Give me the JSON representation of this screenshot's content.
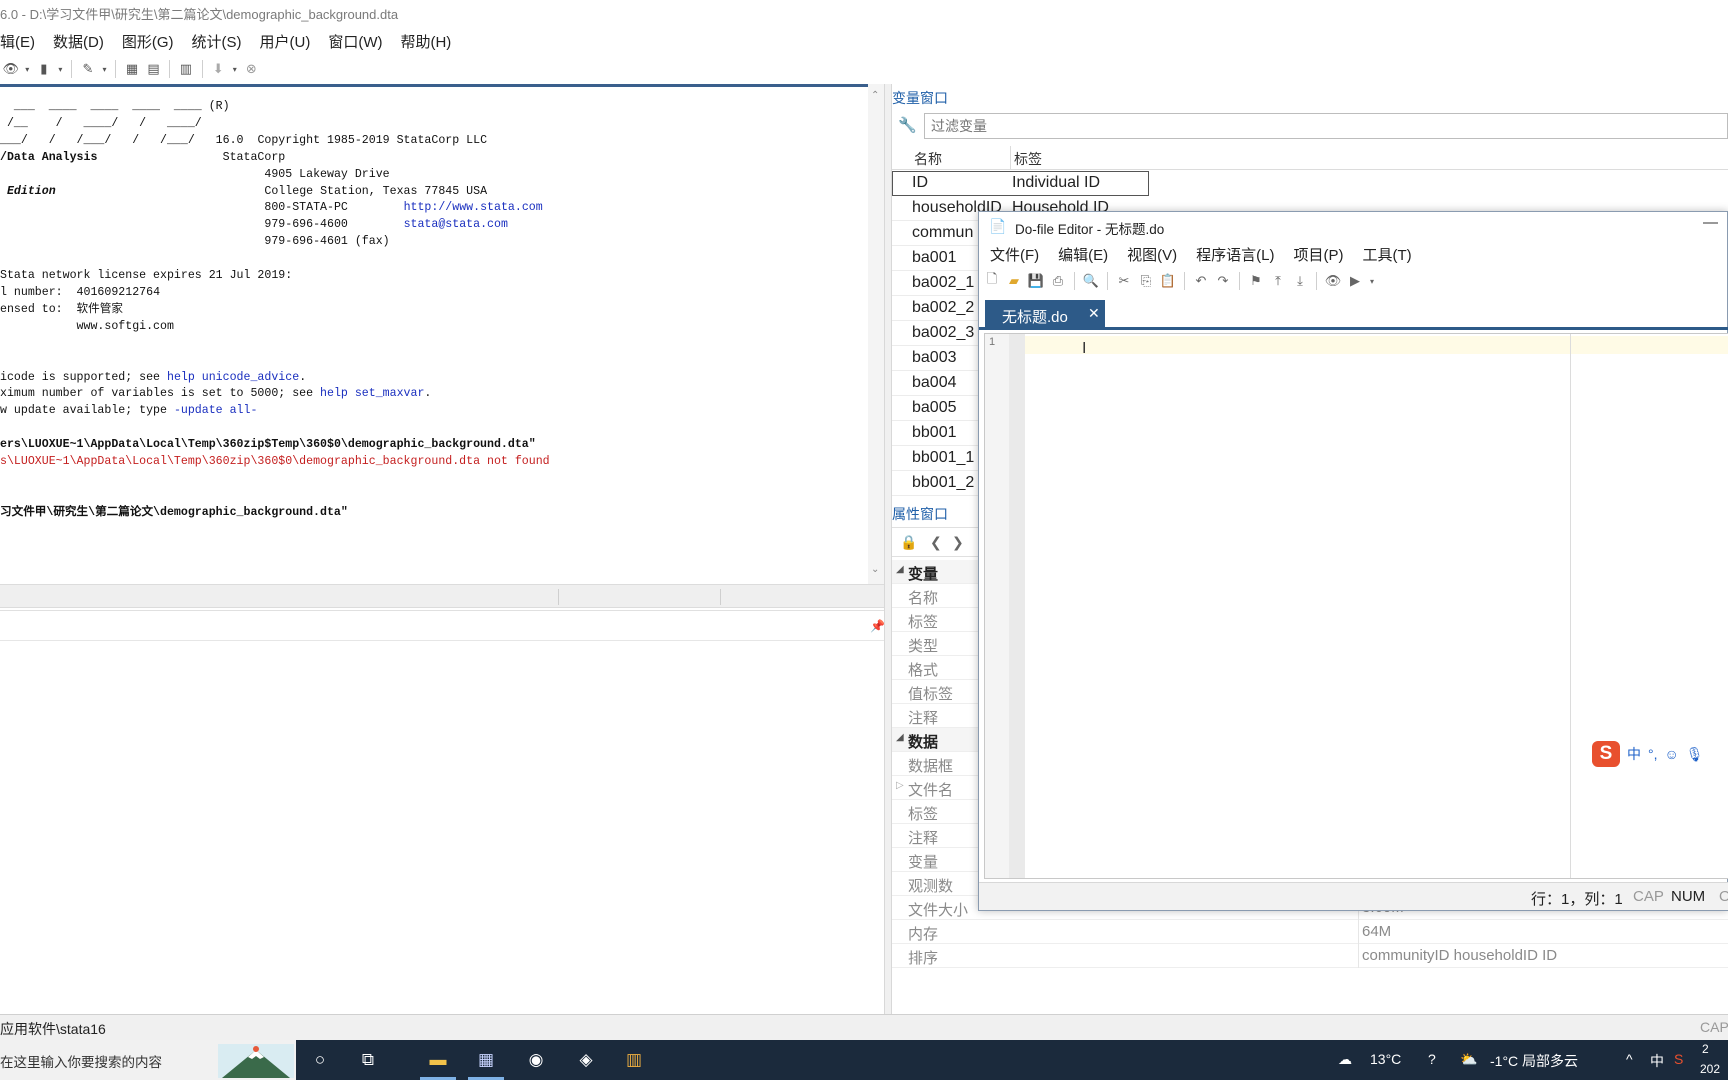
{
  "window": {
    "title": "6.0 - D:\\学习文件甲\\研究生\\第二篇论文\\demographic_background.dta"
  },
  "menu": [
    "辑(E)",
    "数据(D)",
    "图形(G)",
    "统计(S)",
    "用户(U)",
    "窗口(W)",
    "帮助(H)"
  ],
  "results": {
    "logo_lines": [
      "  ___  ____  ____  ____  ____ (R)",
      " /__    /   ____/   /   ____/",
      "___/   /   /___/   /   /___/   16.0"
    ],
    "product_lines": [
      "/Data Analysis",
      " Edition"
    ],
    "copyright": "Copyright 1985-2019 StataCorp LLC",
    "company": "StataCorp",
    "address1": "4905 Lakeway Drive",
    "address2": "College Station, Texas 77845 USA",
    "phone1": "800-STATA-PC",
    "url": "http://www.stata.com",
    "phone2": "979-696-4600",
    "email": "stata@stata.com",
    "fax": "979-696-4601 (fax)",
    "license_line": "Stata network license expires 21 Jul 2019:",
    "serial_label": "l number:",
    "serial": "401609212764",
    "licensed_label": "ensed to:",
    "licensee": "软件管家",
    "licensee_site": "www.softgi.com",
    "notice1_pre": "icode is supported; see ",
    "notice1_link": "help unicode_advice",
    "notice1_post": ".",
    "notice2_pre": "ximum number of variables is set to 5000; see ",
    "notice2_link": "help set_maxvar",
    "notice2_post": ".",
    "notice3_pre": "w update available; type ",
    "notice3_link": "-update all-",
    "use_cmd1": "ers\\LUOXUE~1\\AppData\\Local\\Temp\\360zip$Temp\\360$0\\demographic_background.dta\"",
    "error1": "s\\LUOXUE~1\\AppData\\Local\\Temp\\360zip\\360$0\\demographic_background.dta not found",
    "use_cmd2": "习文件甲\\研究生\\第二篇论文\\demographic_background.dta\""
  },
  "variables_window": {
    "title": "变量窗口",
    "filter_placeholder": "过滤变量",
    "col_name": "名称",
    "col_label": "标签",
    "rows": [
      {
        "name": "ID",
        "label": "Individual ID"
      },
      {
        "name": "householdID",
        "label": "Household ID"
      },
      {
        "name": "commun",
        "label": ""
      },
      {
        "name": "ba001",
        "label": ""
      },
      {
        "name": "ba002_1",
        "label": ""
      },
      {
        "name": "ba002_2",
        "label": ""
      },
      {
        "name": "ba002_3",
        "label": ""
      },
      {
        "name": "ba003",
        "label": ""
      },
      {
        "name": "ba004",
        "label": ""
      },
      {
        "name": "ba005",
        "label": ""
      },
      {
        "name": "bb001",
        "label": ""
      },
      {
        "name": "bb001_1",
        "label": ""
      },
      {
        "name": "bb001_2",
        "label": ""
      }
    ]
  },
  "properties_window": {
    "title": "属性窗口",
    "group_variable": "变量",
    "variable_props": [
      "名称",
      "标签",
      "类型",
      "格式",
      "值标签",
      "注释"
    ],
    "group_data": "数据",
    "data_props": [
      {
        "key": "数据框",
        "value": ""
      },
      {
        "key": "文件名",
        "value": ""
      },
      {
        "key": "标签",
        "value": ""
      },
      {
        "key": "注释",
        "value": ""
      },
      {
        "key": "变量",
        "value": ""
      },
      {
        "key": "观测数",
        "value": ""
      },
      {
        "key": "文件大小",
        "value": "3.60M"
      },
      {
        "key": "内存",
        "value": "64M"
      },
      {
        "key": "排序",
        "value": "communityID householdID ID"
      }
    ]
  },
  "status_bar": {
    "path": "应用软件\\stata16",
    "cap": "CAP"
  },
  "do_editor": {
    "title": "Do-file Editor - 无标题.do",
    "menu": [
      "文件(F)",
      "编辑(E)",
      "视图(V)",
      "程序语言(L)",
      "项目(P)",
      "工具(T)"
    ],
    "tab_name": "无标题.do",
    "line_number": "1",
    "status_pos": "行：1，列：1",
    "status_cap": "CAP",
    "status_num": "NUM",
    "status_ovr": "O"
  },
  "taskbar": {
    "search_placeholder": "在这里输入你要搜索的内容",
    "weather1": "13°C",
    "weather2": "-1°C 局部多云",
    "ime": "中",
    "clock_top": "2",
    "clock_bottom": "202"
  },
  "ime_bar": {
    "label": "中"
  },
  "colors": {
    "accent_blue": "#2d5a88",
    "panel_title": "#1f5fa8",
    "link": "#1a2fbf",
    "error": "#c41e1e",
    "taskbar": "#1b2a3c"
  }
}
